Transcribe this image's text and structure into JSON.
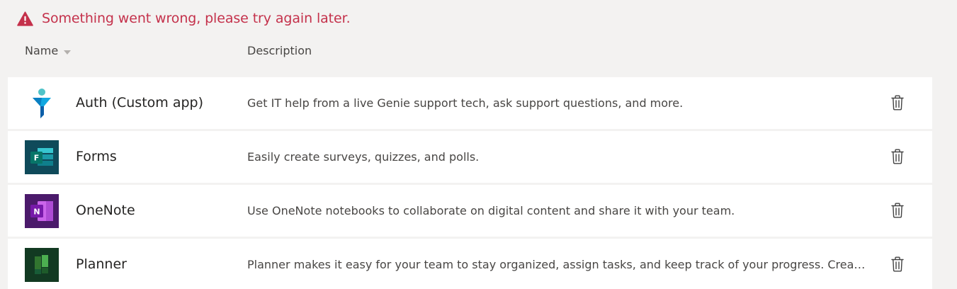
{
  "error": {
    "message": "Something went wrong, please try again later.",
    "icon": "warning-icon",
    "color": "#c4314b"
  },
  "columns": {
    "name": "Name",
    "description": "Description"
  },
  "apps": [
    {
      "name": "Auth (Custom app)",
      "description": "Get IT help from a live Genie support tech, ask support questions, and more.",
      "icon": "auth-app-icon"
    },
    {
      "name": "Forms",
      "description": "Easily create surveys, quizzes, and polls.",
      "icon": "forms-app-icon"
    },
    {
      "name": "OneNote",
      "description": "Use OneNote notebooks to collaborate on digital content and share it with your team.",
      "icon": "onenote-app-icon"
    },
    {
      "name": "Planner",
      "description": "Planner makes it easy for your team to stay organized, assign tasks, and keep track of your progress. Create …",
      "icon": "planner-app-icon"
    }
  ]
}
